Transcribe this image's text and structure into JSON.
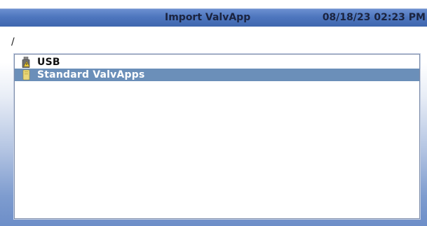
{
  "titlebar": {
    "title": "Import ValvApp",
    "datetime": "08/18/23 02:23 PM"
  },
  "path": "/",
  "file_list": {
    "items": [
      {
        "label": "USB",
        "icon": "usb-drive-icon",
        "selected": false
      },
      {
        "label": "Standard ValvApps",
        "icon": "folder-icon",
        "selected": true
      }
    ]
  },
  "colors": {
    "titlebar": "#4f77bf",
    "selection": "#6b8fb9",
    "title_text": "#1b2440"
  }
}
